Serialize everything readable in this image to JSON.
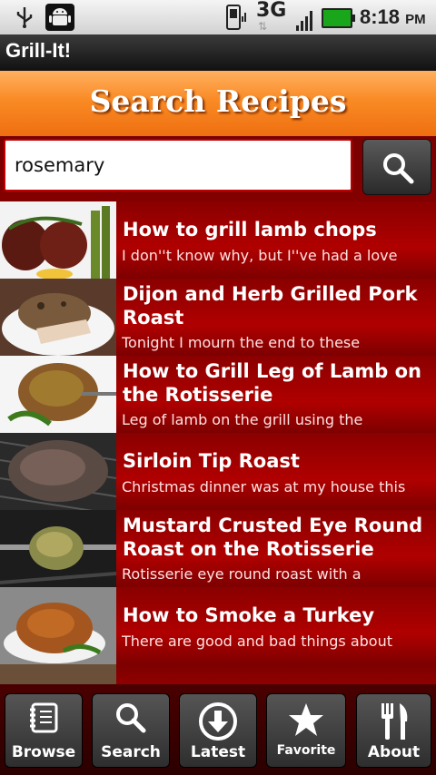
{
  "status_bar": {
    "network": "3G",
    "time": "8:18",
    "ampm": "PM",
    "icons": [
      "usb-icon",
      "android-debug-icon",
      "phone-signal-icon",
      "data-arrows-icon",
      "signal-bars-icon",
      "battery-icon"
    ]
  },
  "app": {
    "title": "Grill-It!"
  },
  "header": {
    "title": "Search Recipes"
  },
  "search": {
    "value": "rosemary",
    "button_icon": "search-icon"
  },
  "recipes": [
    {
      "title": "How to grill lamb chops",
      "desc": "I don''t know why, but I''ve had a love"
    },
    {
      "title": "Dijon and Herb Grilled Pork Roast",
      "desc": "Tonight I mourn the end to these"
    },
    {
      "title": "How to Grill Leg of Lamb on the Rotisserie",
      "desc": "Leg of lamb on the grill using the"
    },
    {
      "title": "Sirloin Tip Roast",
      "desc": "Christmas dinner was at my house this"
    },
    {
      "title": "Mustard Crusted Eye Round Roast on the Rotisserie",
      "desc": "Rotisserie eye round roast with a"
    },
    {
      "title": "How to Smoke a Turkey",
      "desc": "There are good and bad things about"
    }
  ],
  "nav": [
    {
      "label": "Browse",
      "icon": "notebook-icon"
    },
    {
      "label": "Search",
      "icon": "search-icon"
    },
    {
      "label": "Latest",
      "icon": "download-arrow-icon"
    },
    {
      "label": "Favorite",
      "icon": "star-icon"
    },
    {
      "label": "About",
      "icon": "fork-knife-icon"
    }
  ],
  "colors": {
    "accent_orange": "#f98a24",
    "list_red": "#a10000",
    "input_border": "#c00000"
  }
}
